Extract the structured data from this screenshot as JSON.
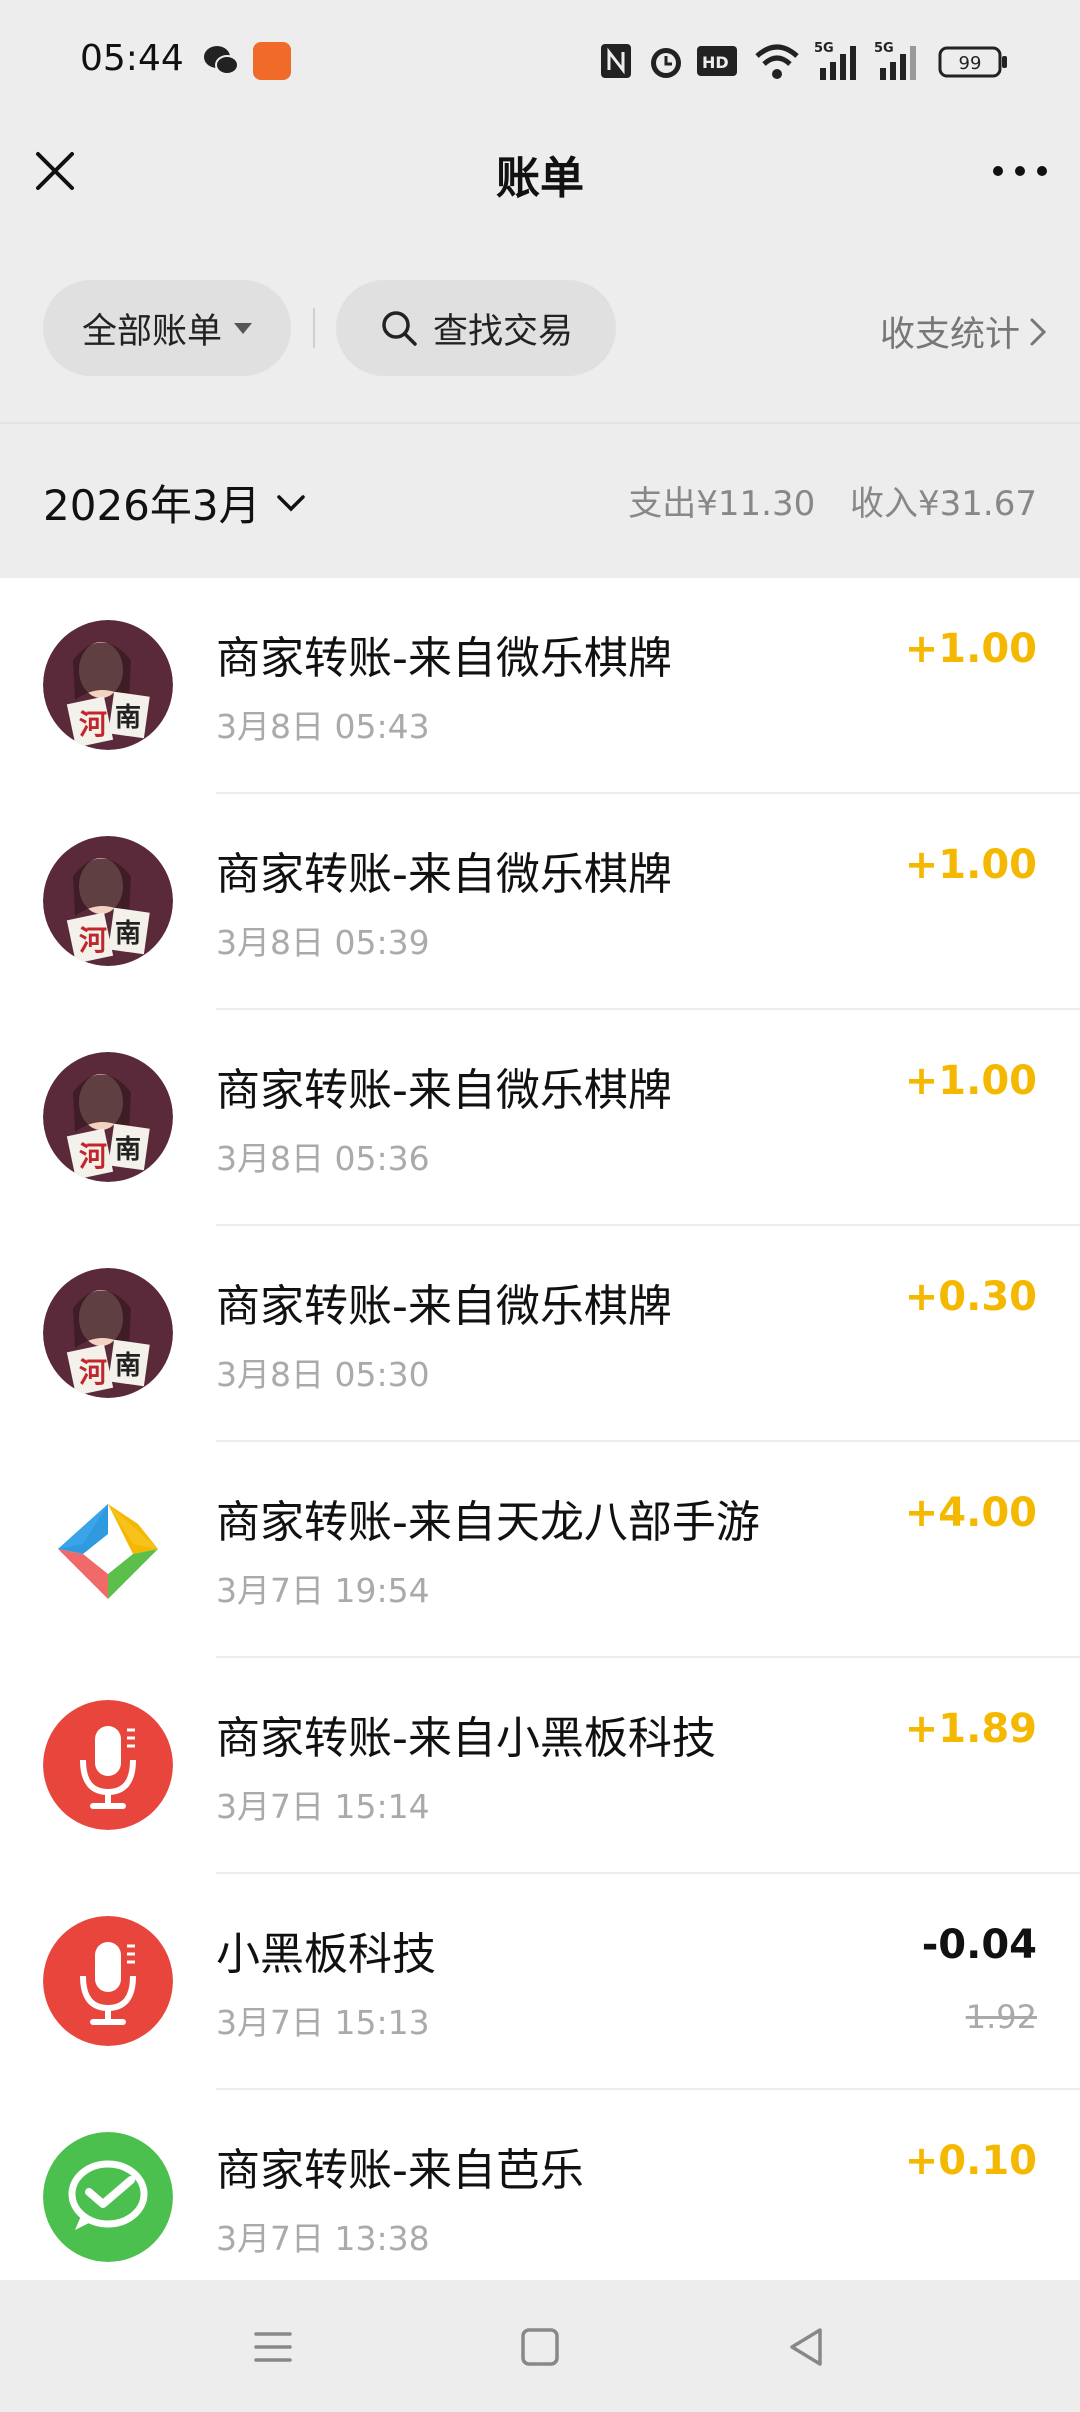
{
  "status_bar": {
    "time": "05:44",
    "battery": "99",
    "icons": [
      "wechat-icon",
      "app-icon",
      "nfc-icon",
      "alarm-icon",
      "hd-icon",
      "wifi-icon",
      "signal-5g-icon",
      "signal-5g-icon",
      "battery-icon"
    ]
  },
  "header": {
    "title": "账单",
    "close_icon": "close-icon",
    "more_icon": "more-icon"
  },
  "filters": {
    "all_bills": "全部账单",
    "search": "查找交易",
    "stats": "收支统计"
  },
  "summary": {
    "month": "2026年3月",
    "expense": "支出¥11.30",
    "income": "收入¥31.67"
  },
  "transactions": [
    {
      "title": "商家转账-来自微乐棋牌",
      "time": "3月8日 05:43",
      "amount": "+1.00",
      "type": "income",
      "avatar": "weile-avatar"
    },
    {
      "title": "商家转账-来自微乐棋牌",
      "time": "3月8日 05:39",
      "amount": "+1.00",
      "type": "income",
      "avatar": "weile-avatar"
    },
    {
      "title": "商家转账-来自微乐棋牌",
      "time": "3月8日 05:36",
      "amount": "+1.00",
      "type": "income",
      "avatar": "weile-avatar"
    },
    {
      "title": "商家转账-来自微乐棋牌",
      "time": "3月8日 05:30",
      "amount": "+0.30",
      "type": "income",
      "avatar": "weile-avatar"
    },
    {
      "title": "商家转账-来自天龙八部手游",
      "time": "3月7日 19:54",
      "amount": "+4.00",
      "type": "income",
      "avatar": "tianlong-avatar"
    },
    {
      "title": "商家转账-来自小黑板科技",
      "time": "3月7日 15:14",
      "amount": "+1.89",
      "type": "income",
      "avatar": "microphone-avatar"
    },
    {
      "title": "小黑板科技",
      "time": "3月7日 15:13",
      "amount": "-0.04",
      "original": "1.92",
      "type": "expense",
      "avatar": "microphone-avatar"
    },
    {
      "title": "商家转账-来自芭乐",
      "time": "3月7日 13:38",
      "amount": "+0.10",
      "type": "income",
      "avatar": "wechatpay-avatar"
    }
  ],
  "colors": {
    "income": "#f5b800",
    "expense": "#111111",
    "background": "#ededed"
  },
  "nav_bar": {
    "icons": [
      "menu-icon",
      "home-icon",
      "back-icon"
    ]
  }
}
